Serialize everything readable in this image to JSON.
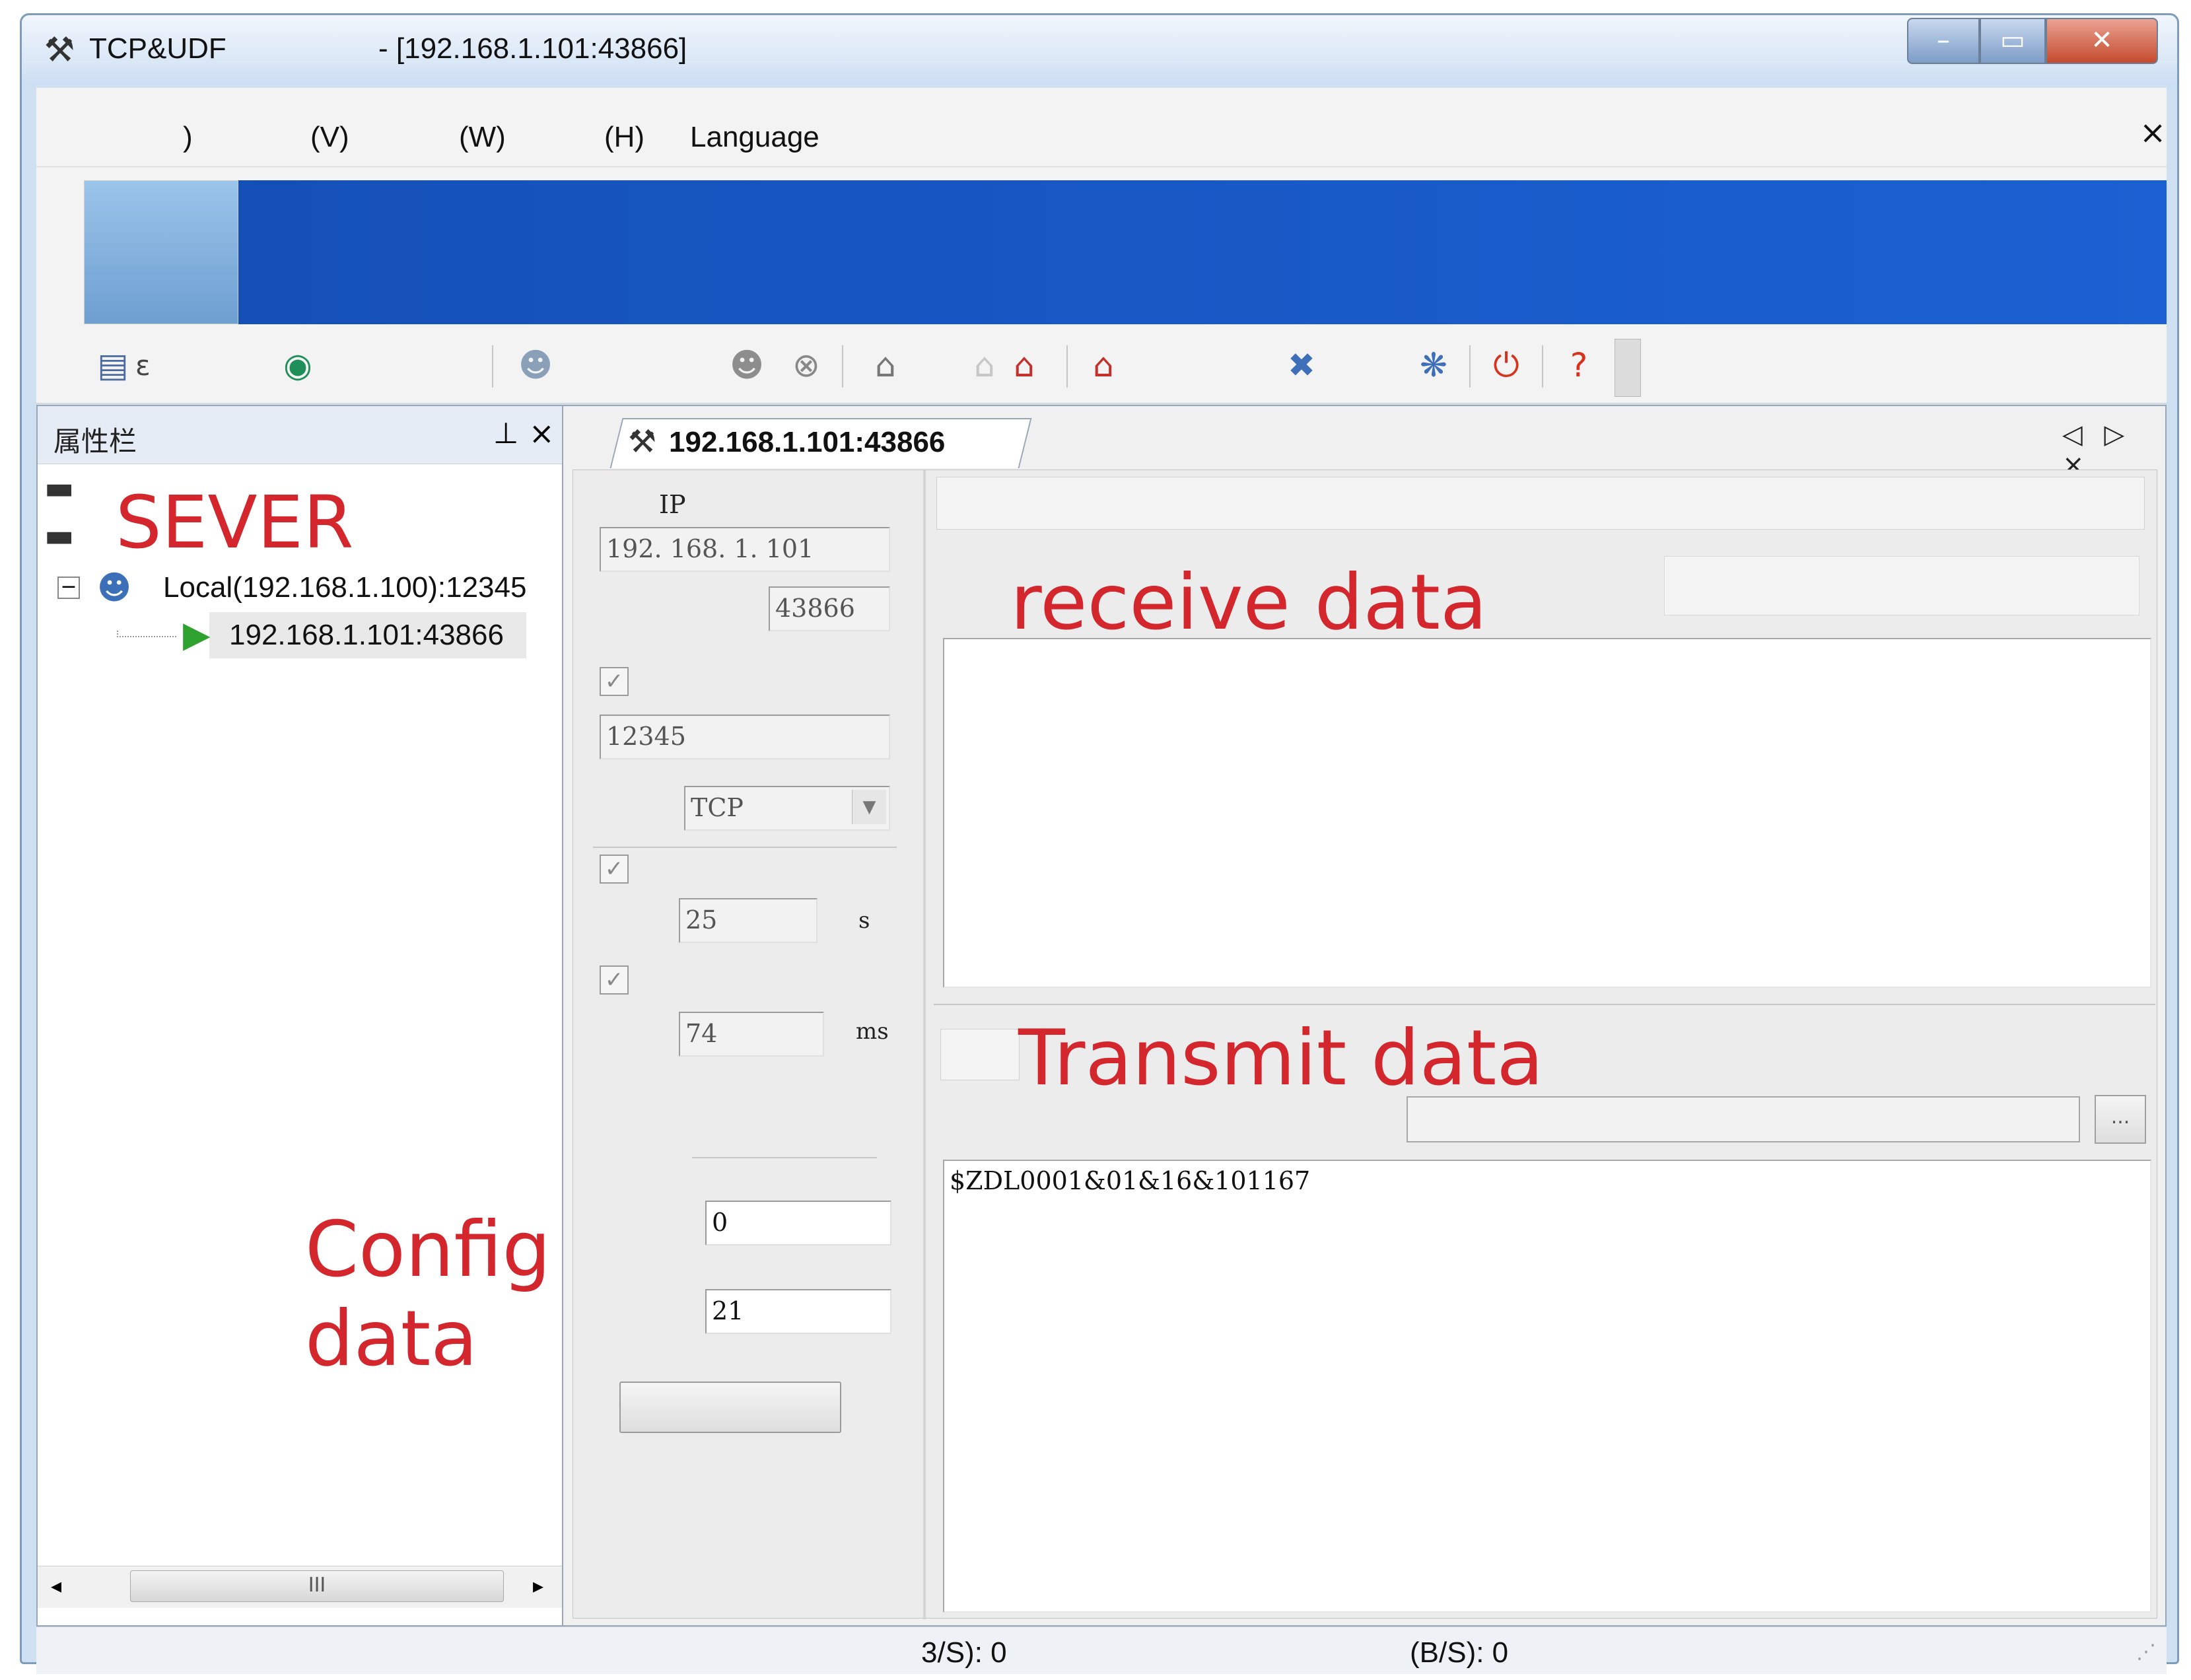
{
  "window": {
    "title_app": "TCP&UDF",
    "title_connection": "- [192.168.1.101:43866]"
  },
  "menu": {
    "items": [
      ")",
      "(V)",
      "(W)",
      "(H)",
      "Language"
    ],
    "close_glyph": "×"
  },
  "toolbar": {
    "icons": [
      "new-icon",
      "globe-icon",
      "users-icon",
      "users-icon",
      "stop-icon",
      "network-icon",
      "network-icon",
      "network-red-icon",
      "network-red-icon",
      "disconnect-icon",
      "connect-icon",
      "power-icon",
      "help-icon"
    ],
    "text_fragment": "ε"
  },
  "property_panel": {
    "title": "属性栏",
    "pin_glyph": "ᵖ",
    "close_glyph": "×",
    "annotation": "SEVER",
    "tree": {
      "local": "Local(192.168.1.100):12345",
      "client": "192.168.1.101:43866"
    },
    "scroll_thumb": "III"
  },
  "document": {
    "tab_label": "192.168.1.101:43866",
    "tab_nav": "◁ ▷ ×"
  },
  "config": {
    "ip_label": "IP",
    "remote_ip": "192. 168. 1. 101",
    "remote_port": "43866",
    "local_port": "12345",
    "protocol": "TCP",
    "interval_s": "25",
    "interval_s_unit": "s",
    "interval_ms": "74",
    "interval_ms_unit": "ms",
    "field_a": "0",
    "field_b": "21",
    "annotation": "Config data"
  },
  "receive": {
    "annotation": "receive data"
  },
  "transmit": {
    "annotation": "Transmit data",
    "browse_glyph": "...",
    "content": "$ZDL0001&01&16&101167"
  },
  "status": {
    "rx_rate": "3/S): 0",
    "tx_rate": "(B/S): 0"
  }
}
